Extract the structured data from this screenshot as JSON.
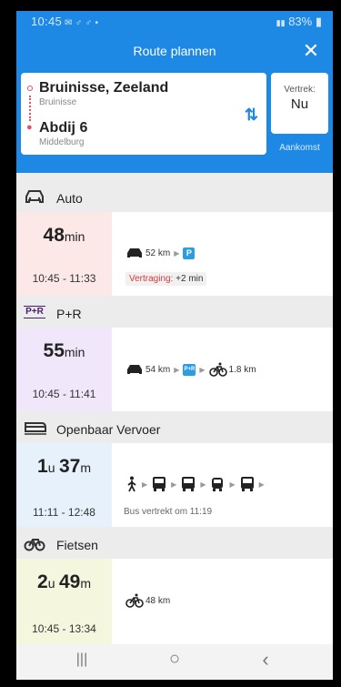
{
  "status": {
    "time": "10:45",
    "icons_left": "✉ ♂ ♂ •",
    "battery": "83%"
  },
  "header": {
    "title": "Route plannen",
    "close_label": "✕"
  },
  "route": {
    "from": {
      "name": "Bruinisse, Zeeland",
      "sub": "Bruinisse"
    },
    "to": {
      "name": "Abdij 6",
      "sub": "Middelburg"
    },
    "swap_label": "⇅"
  },
  "departure": {
    "label": "Vertrek:",
    "value": "Nu",
    "arrival_link": "Aankomst"
  },
  "sections": {
    "auto": {
      "label": "Auto"
    },
    "pr": {
      "label": "P+R",
      "icon_text": "P+R"
    },
    "ov": {
      "label": "Openbaar Vervoer"
    },
    "fiets": {
      "label": "Fietsen"
    }
  },
  "cards": {
    "auto": {
      "dur_num": "48",
      "dur_unit": "min",
      "times": "10:45 - 11:33",
      "distance": "52 km",
      "parking": "P",
      "delay_label": "Vertraging:",
      "delay_value": " +2 min"
    },
    "pr": {
      "dur_num": "55",
      "dur_unit": "min",
      "times": "10:45 - 11:41",
      "car_distance": "54 km",
      "pr_badge": "P+R",
      "bike_distance": "1.8 km"
    },
    "ov": {
      "dur_h": "1",
      "dur_h_unit": "u",
      "dur_m": "37",
      "dur_m_unit": "m",
      "times": "11:11 - 12:48",
      "note": "Bus vertrekt om 11:19"
    },
    "fiets": {
      "dur_h": "2",
      "dur_h_unit": "u",
      "dur_m": "49",
      "dur_m_unit": "m",
      "times": "10:45 - 13:34",
      "distance": "48 km"
    }
  },
  "colors": {
    "header": "#1e88e5",
    "auto_accent": "#fde8e8",
    "pr_accent": "#f1e7fa",
    "ov_accent": "#e6f1fb",
    "fiets_accent": "#f4f6dd"
  },
  "nav": {
    "recents": "|||",
    "home": "○",
    "back": "‹"
  }
}
